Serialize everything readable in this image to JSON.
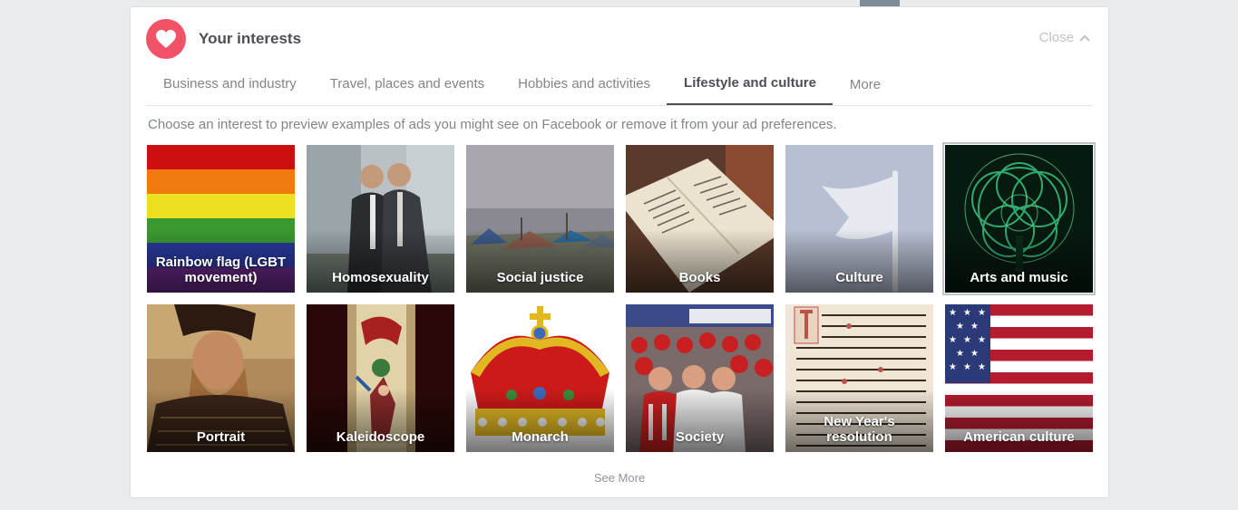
{
  "header": {
    "title": "Your interests",
    "close_label": "Close",
    "icon": "heart-icon",
    "icon_color": "#f25268"
  },
  "tabs": [
    {
      "label": "Business and industry",
      "active": false
    },
    {
      "label": "Travel, places and events",
      "active": false
    },
    {
      "label": "Hobbies and activities",
      "active": false
    },
    {
      "label": "Lifestyle and culture",
      "active": true
    },
    {
      "label": "More",
      "active": false
    }
  ],
  "description": "Choose an interest to preview examples of ads you might see on Facebook or remove it from your ad preferences.",
  "interests": [
    {
      "label": "Rainbow flag (LGBT movement)",
      "image": "rainbow-flag"
    },
    {
      "label": "Homosexuality",
      "image": "two-men-photo"
    },
    {
      "label": "Social justice",
      "image": "tent-camp-photo"
    },
    {
      "label": "Books",
      "image": "open-book-photo"
    },
    {
      "label": "Culture",
      "image": "white-flag"
    },
    {
      "label": "Arts and music",
      "image": "green-light-art",
      "selected": true
    },
    {
      "label": "Portrait",
      "image": "painted-portrait"
    },
    {
      "label": "Kaleidoscope",
      "image": "kaleidoscope-tube"
    },
    {
      "label": "Monarch",
      "image": "royal-crown"
    },
    {
      "label": "Society",
      "image": "stadium-crowd-photo"
    },
    {
      "label": "New Year's resolution",
      "image": "old-text-page"
    },
    {
      "label": "American culture",
      "image": "us-flag"
    }
  ],
  "see_more_label": "See More"
}
